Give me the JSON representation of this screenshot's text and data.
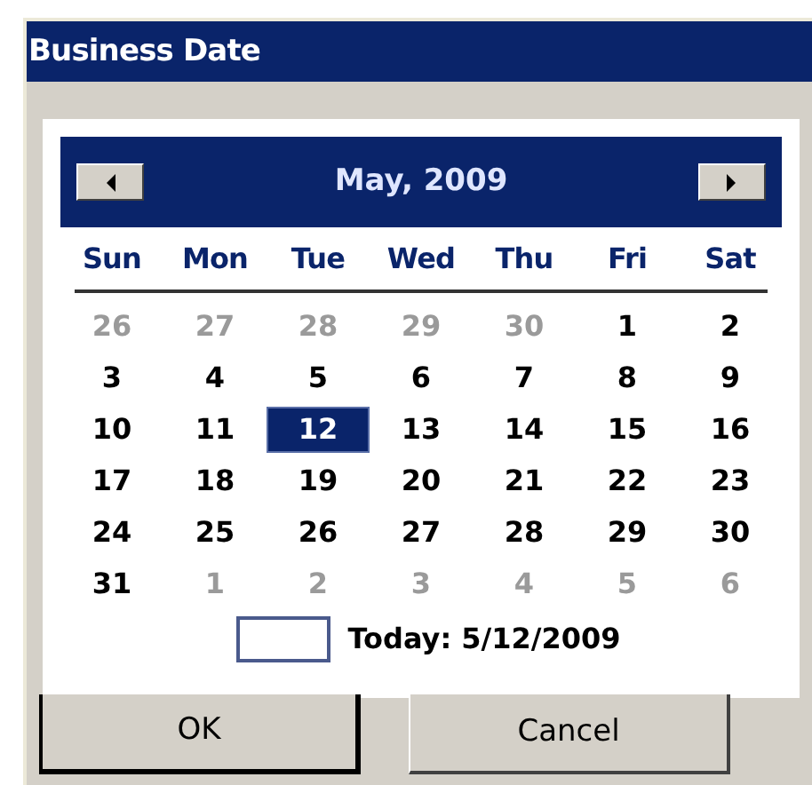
{
  "window": {
    "title": "Business Date"
  },
  "calendar": {
    "month": "May, 2009",
    "weekdays": [
      "Sun",
      "Mon",
      "Tue",
      "Wed",
      "Thu",
      "Fri",
      "Sat"
    ],
    "weeks": [
      [
        {
          "day": "26",
          "other_month": true,
          "selected": false
        },
        {
          "day": "27",
          "other_month": true,
          "selected": false
        },
        {
          "day": "28",
          "other_month": true,
          "selected": false
        },
        {
          "day": "29",
          "other_month": true,
          "selected": false
        },
        {
          "day": "30",
          "other_month": true,
          "selected": false
        },
        {
          "day": "1",
          "other_month": false,
          "selected": false
        },
        {
          "day": "2",
          "other_month": false,
          "selected": false
        }
      ],
      [
        {
          "day": "3",
          "other_month": false,
          "selected": false
        },
        {
          "day": "4",
          "other_month": false,
          "selected": false
        },
        {
          "day": "5",
          "other_month": false,
          "selected": false
        },
        {
          "day": "6",
          "other_month": false,
          "selected": false
        },
        {
          "day": "7",
          "other_month": false,
          "selected": false
        },
        {
          "day": "8",
          "other_month": false,
          "selected": false
        },
        {
          "day": "9",
          "other_month": false,
          "selected": false
        }
      ],
      [
        {
          "day": "10",
          "other_month": false,
          "selected": false
        },
        {
          "day": "11",
          "other_month": false,
          "selected": false
        },
        {
          "day": "12",
          "other_month": false,
          "selected": true
        },
        {
          "day": "13",
          "other_month": false,
          "selected": false
        },
        {
          "day": "14",
          "other_month": false,
          "selected": false
        },
        {
          "day": "15",
          "other_month": false,
          "selected": false
        },
        {
          "day": "16",
          "other_month": false,
          "selected": false
        }
      ],
      [
        {
          "day": "17",
          "other_month": false,
          "selected": false
        },
        {
          "day": "18",
          "other_month": false,
          "selected": false
        },
        {
          "day": "19",
          "other_month": false,
          "selected": false
        },
        {
          "day": "20",
          "other_month": false,
          "selected": false
        },
        {
          "day": "21",
          "other_month": false,
          "selected": false
        },
        {
          "day": "22",
          "other_month": false,
          "selected": false
        },
        {
          "day": "23",
          "other_month": false,
          "selected": false
        }
      ],
      [
        {
          "day": "24",
          "other_month": false,
          "selected": false
        },
        {
          "day": "25",
          "other_month": false,
          "selected": false
        },
        {
          "day": "26",
          "other_month": false,
          "selected": false
        },
        {
          "day": "27",
          "other_month": false,
          "selected": false
        },
        {
          "day": "28",
          "other_month": false,
          "selected": false
        },
        {
          "day": "29",
          "other_month": false,
          "selected": false
        },
        {
          "day": "30",
          "other_month": false,
          "selected": false
        }
      ],
      [
        {
          "day": "31",
          "other_month": false,
          "selected": false
        },
        {
          "day": "1",
          "other_month": true,
          "selected": false
        },
        {
          "day": "2",
          "other_month": true,
          "selected": false
        },
        {
          "day": "3",
          "other_month": true,
          "selected": false
        },
        {
          "day": "4",
          "other_month": true,
          "selected": false
        },
        {
          "day": "5",
          "other_month": true,
          "selected": false
        },
        {
          "day": "6",
          "other_month": true,
          "selected": false
        }
      ]
    ],
    "today": "Today: 5/12/2009"
  },
  "buttons": [
    {
      "label": "OK",
      "default": true
    },
    {
      "label": "Cancel",
      "default": false
    }
  ]
}
